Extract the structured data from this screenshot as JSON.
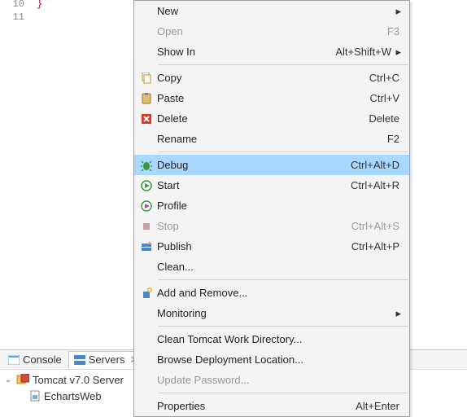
{
  "editor": {
    "line_numbers": [
      "10",
      "11"
    ],
    "code_brace": "}"
  },
  "bottom": {
    "tabs": {
      "console": "Console",
      "servers": "Servers"
    },
    "tree": {
      "server": "Tomcat v7.0 Server",
      "child": "EchartsWeb"
    }
  },
  "menu": {
    "new": {
      "label": "New"
    },
    "open": {
      "label": "Open",
      "accel": "F3"
    },
    "show_in": {
      "label": "Show In",
      "accel": "Alt+Shift+W"
    },
    "copy": {
      "label": "Copy",
      "accel": "Ctrl+C"
    },
    "paste": {
      "label": "Paste",
      "accel": "Ctrl+V"
    },
    "delete": {
      "label": "Delete",
      "accel": "Delete"
    },
    "rename": {
      "label": "Rename",
      "accel": "F2"
    },
    "debug": {
      "label": "Debug",
      "accel": "Ctrl+Alt+D"
    },
    "start": {
      "label": "Start",
      "accel": "Ctrl+Alt+R"
    },
    "profile": {
      "label": "Profile"
    },
    "stop": {
      "label": "Stop",
      "accel": "Ctrl+Alt+S"
    },
    "publish": {
      "label": "Publish",
      "accel": "Ctrl+Alt+P"
    },
    "clean": {
      "label": "Clean..."
    },
    "add_remove": {
      "label": "Add and Remove..."
    },
    "monitoring": {
      "label": "Monitoring"
    },
    "clean_tomcat": {
      "label": "Clean Tomcat Work Directory..."
    },
    "browse_deploy": {
      "label": "Browse Deployment Location..."
    },
    "update_pw": {
      "label": "Update Password..."
    },
    "properties": {
      "label": "Properties",
      "accel": "Alt+Enter"
    }
  }
}
